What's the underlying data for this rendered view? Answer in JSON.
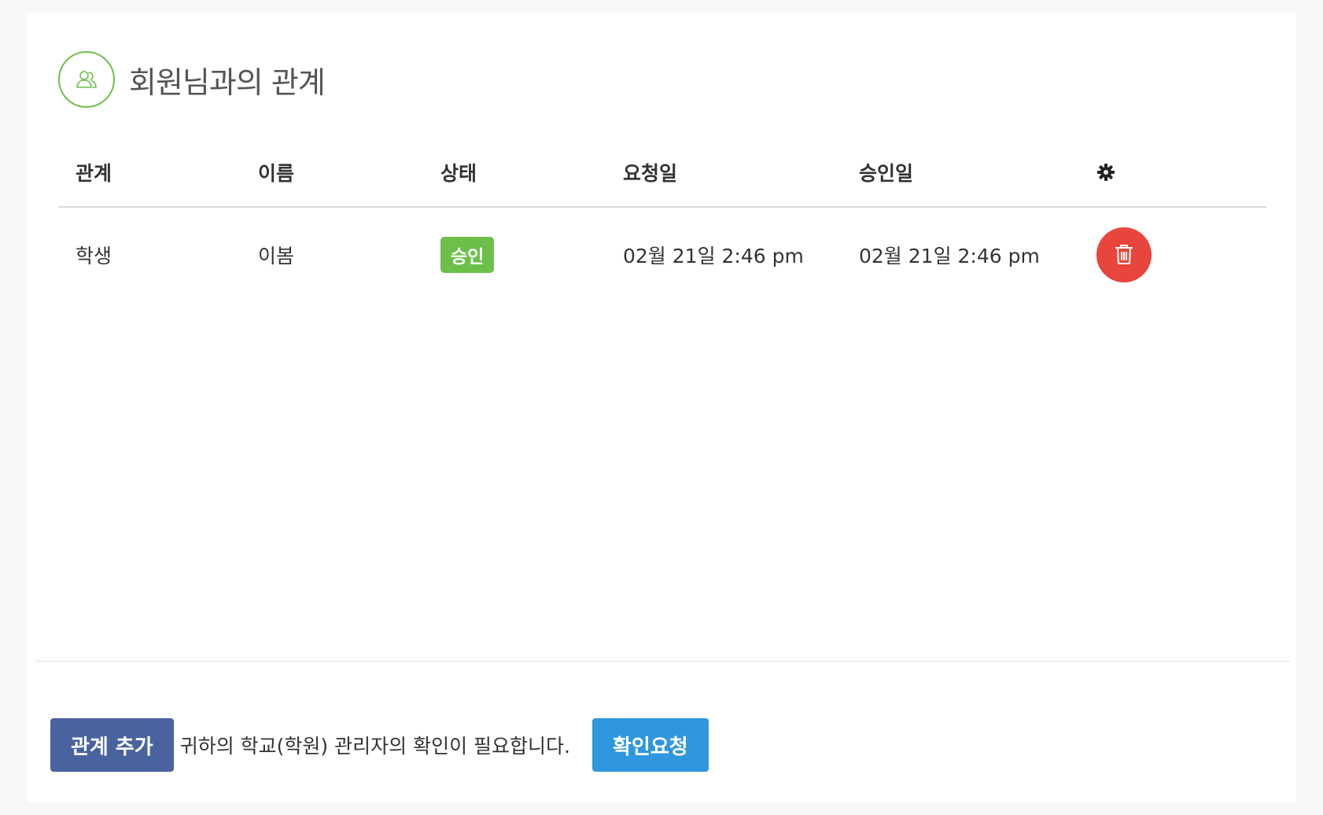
{
  "header": {
    "title": "회원님과의 관계",
    "icon": "users-icon",
    "accent_color": "#6cc04a"
  },
  "table": {
    "columns": [
      "관계",
      "이름",
      "상태",
      "요청일",
      "승인일"
    ],
    "settings_icon": "gear-icon",
    "rows": [
      {
        "relation": "학생",
        "name": "이봄",
        "status": "승인",
        "requested": "02월 21일 2:46 pm",
        "approved": "02월 21일 2:46 pm",
        "action_icon": "trash-icon"
      }
    ]
  },
  "footer": {
    "add_label": "관계 추가",
    "notice": "귀하의 학교(학원) 관리자의 확인이 필요합니다.",
    "confirm_label": "확인요청"
  },
  "colors": {
    "status_approved": "#6cc04a",
    "delete": "#e8453c",
    "add_button": "#49639e",
    "confirm_button": "#2f97dd"
  }
}
